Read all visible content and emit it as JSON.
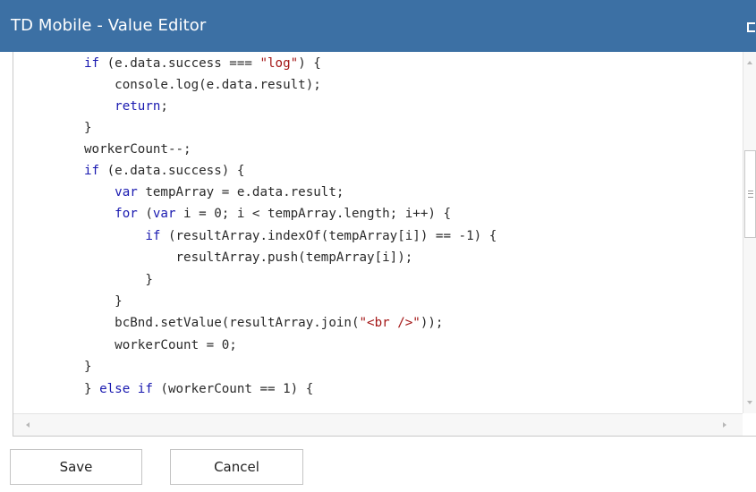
{
  "window": {
    "title": "TD Mobile - Value Editor"
  },
  "editor": {
    "lines": [
      [
        {
          "t": "if",
          "c": "kw"
        },
        {
          "t": " (e.data.success === "
        },
        {
          "t": "\"log\"",
          "c": "str"
        },
        {
          "t": ") {"
        }
      ],
      [
        {
          "t": "    console.log(e.data.result);"
        }
      ],
      [
        {
          "t": "    "
        },
        {
          "t": "return",
          "c": "kw"
        },
        {
          "t": ";"
        }
      ],
      [
        {
          "t": "}"
        }
      ],
      [
        {
          "t": "workerCount--;"
        }
      ],
      [
        {
          "t": "if",
          "c": "kw"
        },
        {
          "t": " (e.data.success) {"
        }
      ],
      [
        {
          "t": "    "
        },
        {
          "t": "var",
          "c": "kw"
        },
        {
          "t": " tempArray = e.data.result;"
        }
      ],
      [
        {
          "t": "    "
        },
        {
          "t": "for",
          "c": "kw"
        },
        {
          "t": " ("
        },
        {
          "t": "var",
          "c": "kw"
        },
        {
          "t": " i = 0; i < tempArray.length; i++) {"
        }
      ],
      [
        {
          "t": "        "
        },
        {
          "t": "if",
          "c": "kw"
        },
        {
          "t": " (resultArray.indexOf(tempArray[i]) == -1) {"
        }
      ],
      [
        {
          "t": "            resultArray.push(tempArray[i]);"
        }
      ],
      [
        {
          "t": "        }"
        }
      ],
      [
        {
          "t": "    }"
        }
      ],
      [
        {
          "t": "    bcBnd.setValue(resultArray.join("
        },
        {
          "t": "\"<br />\"",
          "c": "str"
        },
        {
          "t": "));"
        }
      ],
      [
        {
          "t": "    workerCount = 0;"
        }
      ],
      [
        {
          "t": "}"
        }
      ],
      [
        {
          "t": "} "
        },
        {
          "t": "else if",
          "c": "kw"
        },
        {
          "t": " (workerCount == 1) {"
        }
      ]
    ]
  },
  "buttons": {
    "save_label": "Save",
    "cancel_label": "Cancel"
  },
  "colors": {
    "titlebar": "#3c70a4",
    "keyword": "#1a1ab0",
    "string": "#a31515",
    "text": "#2a2a2a"
  },
  "icons": {
    "window_control": "maximize-icon",
    "scroll_up": "arrow-up-icon",
    "scroll_down": "arrow-down-icon",
    "scroll_left": "arrow-left-icon",
    "scroll_right": "arrow-right-icon"
  }
}
